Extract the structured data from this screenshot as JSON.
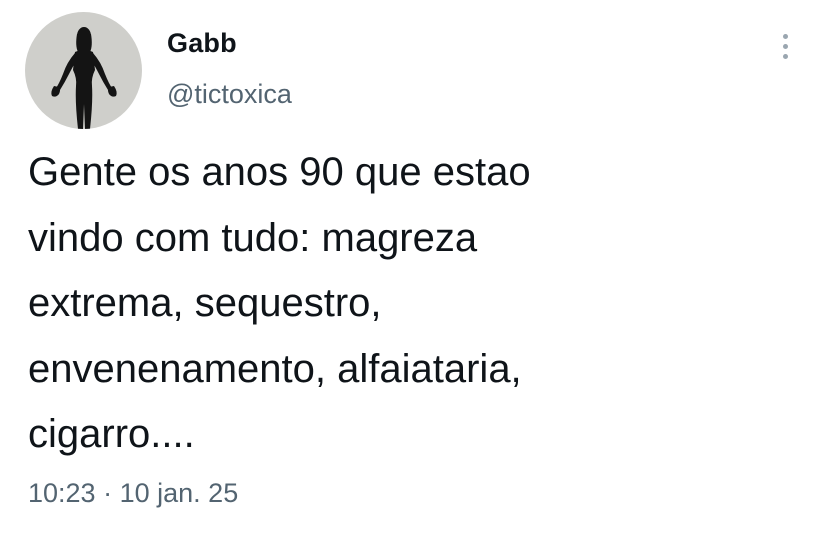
{
  "author": {
    "display_name": "Gabb",
    "handle": "@tictoxica",
    "avatar": "silhouette-figure-icon"
  },
  "tweet": {
    "text": "Gente os anos 90 que estao\nvindo com tudo: magreza\nextrema, sequestro,\nenvenenamento, alfaiataria,\ncigarro....",
    "time": "10:23",
    "separator": "·",
    "date": "10 jan. 25"
  },
  "menu": {
    "icon": "more-vertical-icon"
  },
  "colors": {
    "text": "#0f1419",
    "secondary": "#536471",
    "avatar_bg": "#cfcfcb"
  }
}
